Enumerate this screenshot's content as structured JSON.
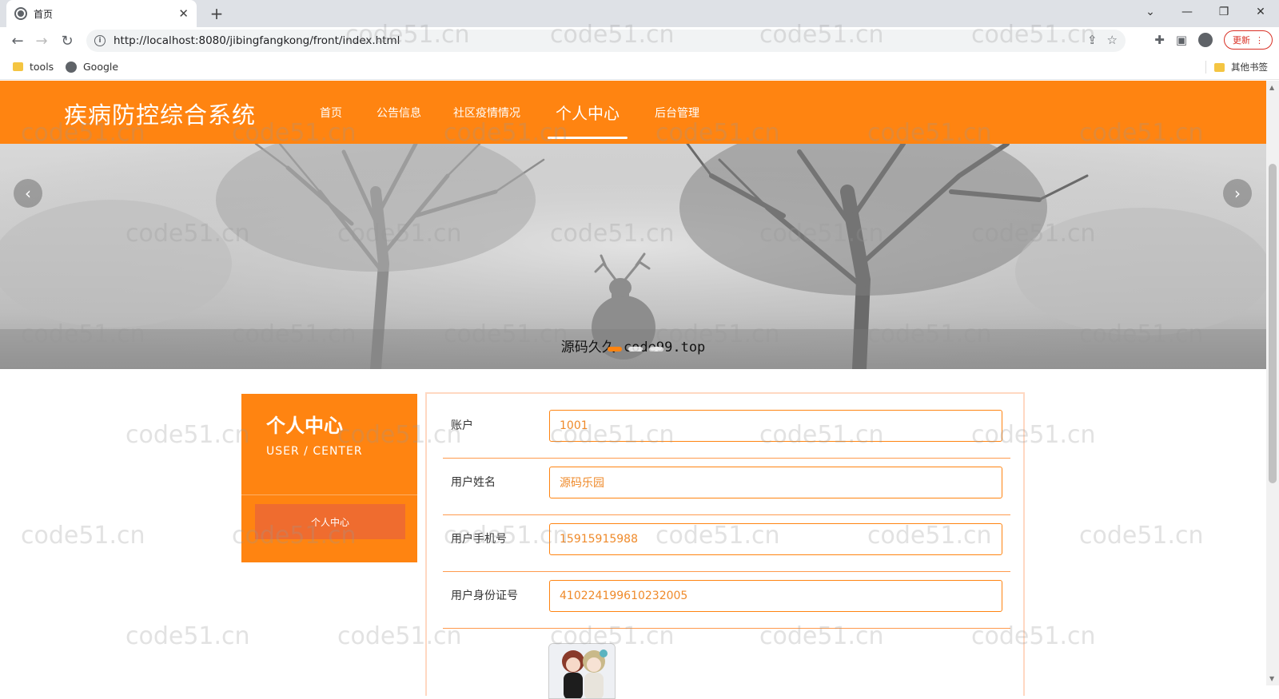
{
  "browser": {
    "tab_title": "首页",
    "url": "http://localhost:8080/jibingfangkong/front/index.html",
    "update_label": "更新",
    "bookmarks": [
      {
        "label": "tools",
        "icon": "folder-icon"
      },
      {
        "label": "Google",
        "icon": "globe-icon"
      }
    ],
    "other_bookmarks": "其他书签"
  },
  "site": {
    "title": "疾病防控综合系统",
    "nav": [
      "首页",
      "公告信息",
      "社区疫情情况",
      "个人中心",
      "后台管理"
    ],
    "active_nav": "个人中心",
    "accent_color": "#ff8411"
  },
  "banner": {
    "caption": "源码久久-code99.top",
    "prev_icon": "chevron-left-icon",
    "next_icon": "chevron-right-icon"
  },
  "side": {
    "title": "个人中心",
    "subtitle": "USER / CENTER",
    "menu_item": "个人中心"
  },
  "form": {
    "fields": [
      {
        "label": "账户",
        "value": "1001"
      },
      {
        "label": "用户姓名",
        "value": "源码乐园"
      },
      {
        "label": "用户手机号",
        "value": "15915915988"
      },
      {
        "label": "用户身份证号",
        "value": "410224199610232005"
      }
    ]
  },
  "watermark": "code51.cn"
}
